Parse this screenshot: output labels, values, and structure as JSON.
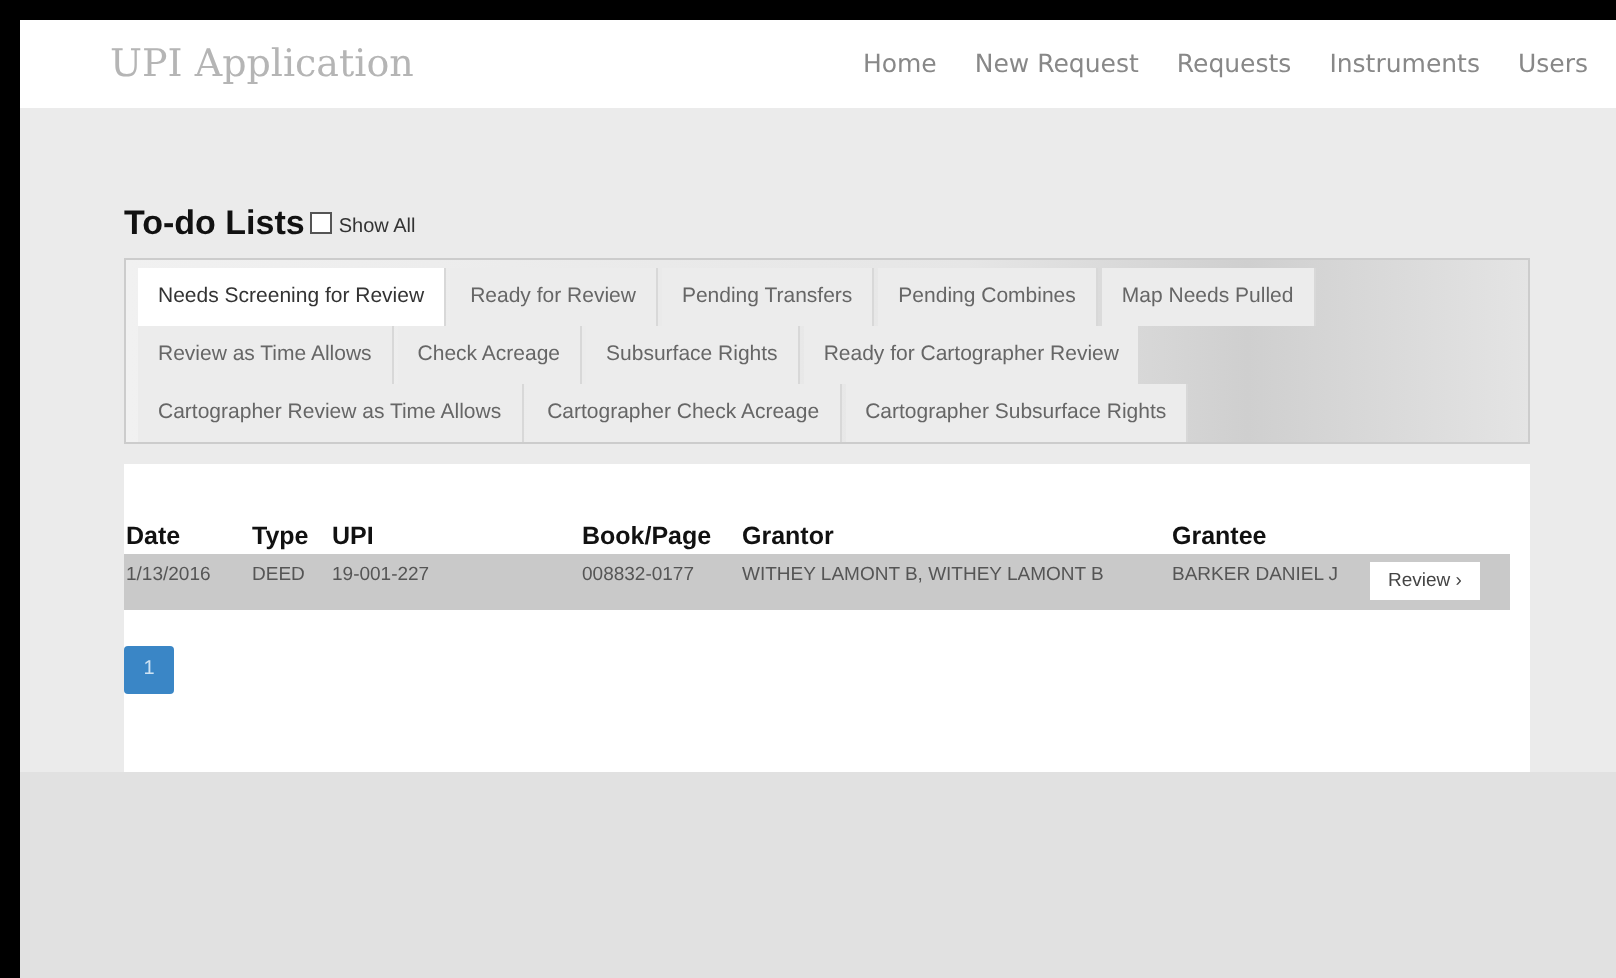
{
  "header": {
    "title": "UPI Application",
    "nav": [
      "Home",
      "New Request",
      "Requests",
      "Instruments",
      "Users"
    ]
  },
  "heading": {
    "title": "To-do Lists",
    "show_all": {
      "label": "Show All",
      "checked": false
    }
  },
  "tab_rows": [
    [
      {
        "label": "Needs Screening for Review",
        "selected": true
      },
      {
        "label": "Ready for Review",
        "selected": false
      },
      {
        "label": "Pending Transfers",
        "selected": false
      },
      {
        "label": "Pending Combines",
        "selected": false
      },
      {
        "label": "Map Needs Pulled",
        "selected": false
      }
    ],
    [
      {
        "label": "Review as Time Allows",
        "selected": false
      },
      {
        "label": "Check Acreage",
        "selected": false
      },
      {
        "label": "Subsurface Rights",
        "selected": false
      },
      {
        "label": "Ready for Cartographer Review",
        "selected": false
      }
    ],
    [
      {
        "label": "Cartographer Review as Time Allows",
        "selected": false
      },
      {
        "label": "Cartographer Check Acreage",
        "selected": false
      },
      {
        "label": "Cartographer Subsurface Rights",
        "selected": false
      }
    ]
  ],
  "table": {
    "columns": [
      "Date",
      "Type",
      "UPI",
      "Book/Page",
      "Grantor",
      "Grantee"
    ],
    "rows": [
      {
        "cells": [
          "1/13/2016",
          "DEED",
          "19-001-227",
          "008832-0177",
          "WITHEY LAMONT B, WITHEY LAMONT B",
          "BARKER DANIEL J"
        ],
        "action": "Review ›"
      }
    ]
  },
  "pagination": [
    {
      "label": "1",
      "selected": true
    }
  ]
}
